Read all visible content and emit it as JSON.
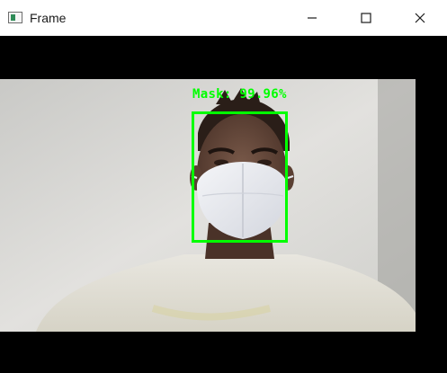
{
  "window": {
    "title": "Frame",
    "controls": {
      "minimize_icon": "minimize-icon",
      "maximize_icon": "maximize-icon",
      "close_icon": "close-icon"
    }
  },
  "video": {
    "detection_label": "Mask: 99.96%",
    "box_color": "#00ff00"
  }
}
